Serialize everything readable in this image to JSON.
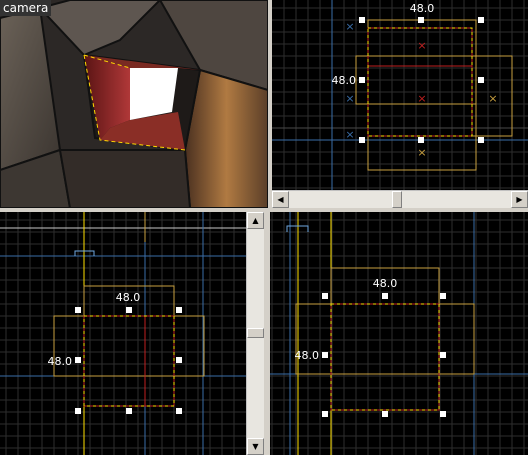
{
  "camera_view": {
    "label": "camera"
  },
  "top_view": {
    "width_label": "48.0",
    "height_label": "48.0"
  },
  "front_view": {
    "width_label": "48.0",
    "height_label": "48.0"
  },
  "side_view": {
    "width_label": "48.0",
    "height_label": "48.0"
  },
  "scrollbar": {
    "left_arrow": "◀",
    "right_arrow": "▶",
    "up_arrow": "▲",
    "down_arrow": "▼"
  }
}
